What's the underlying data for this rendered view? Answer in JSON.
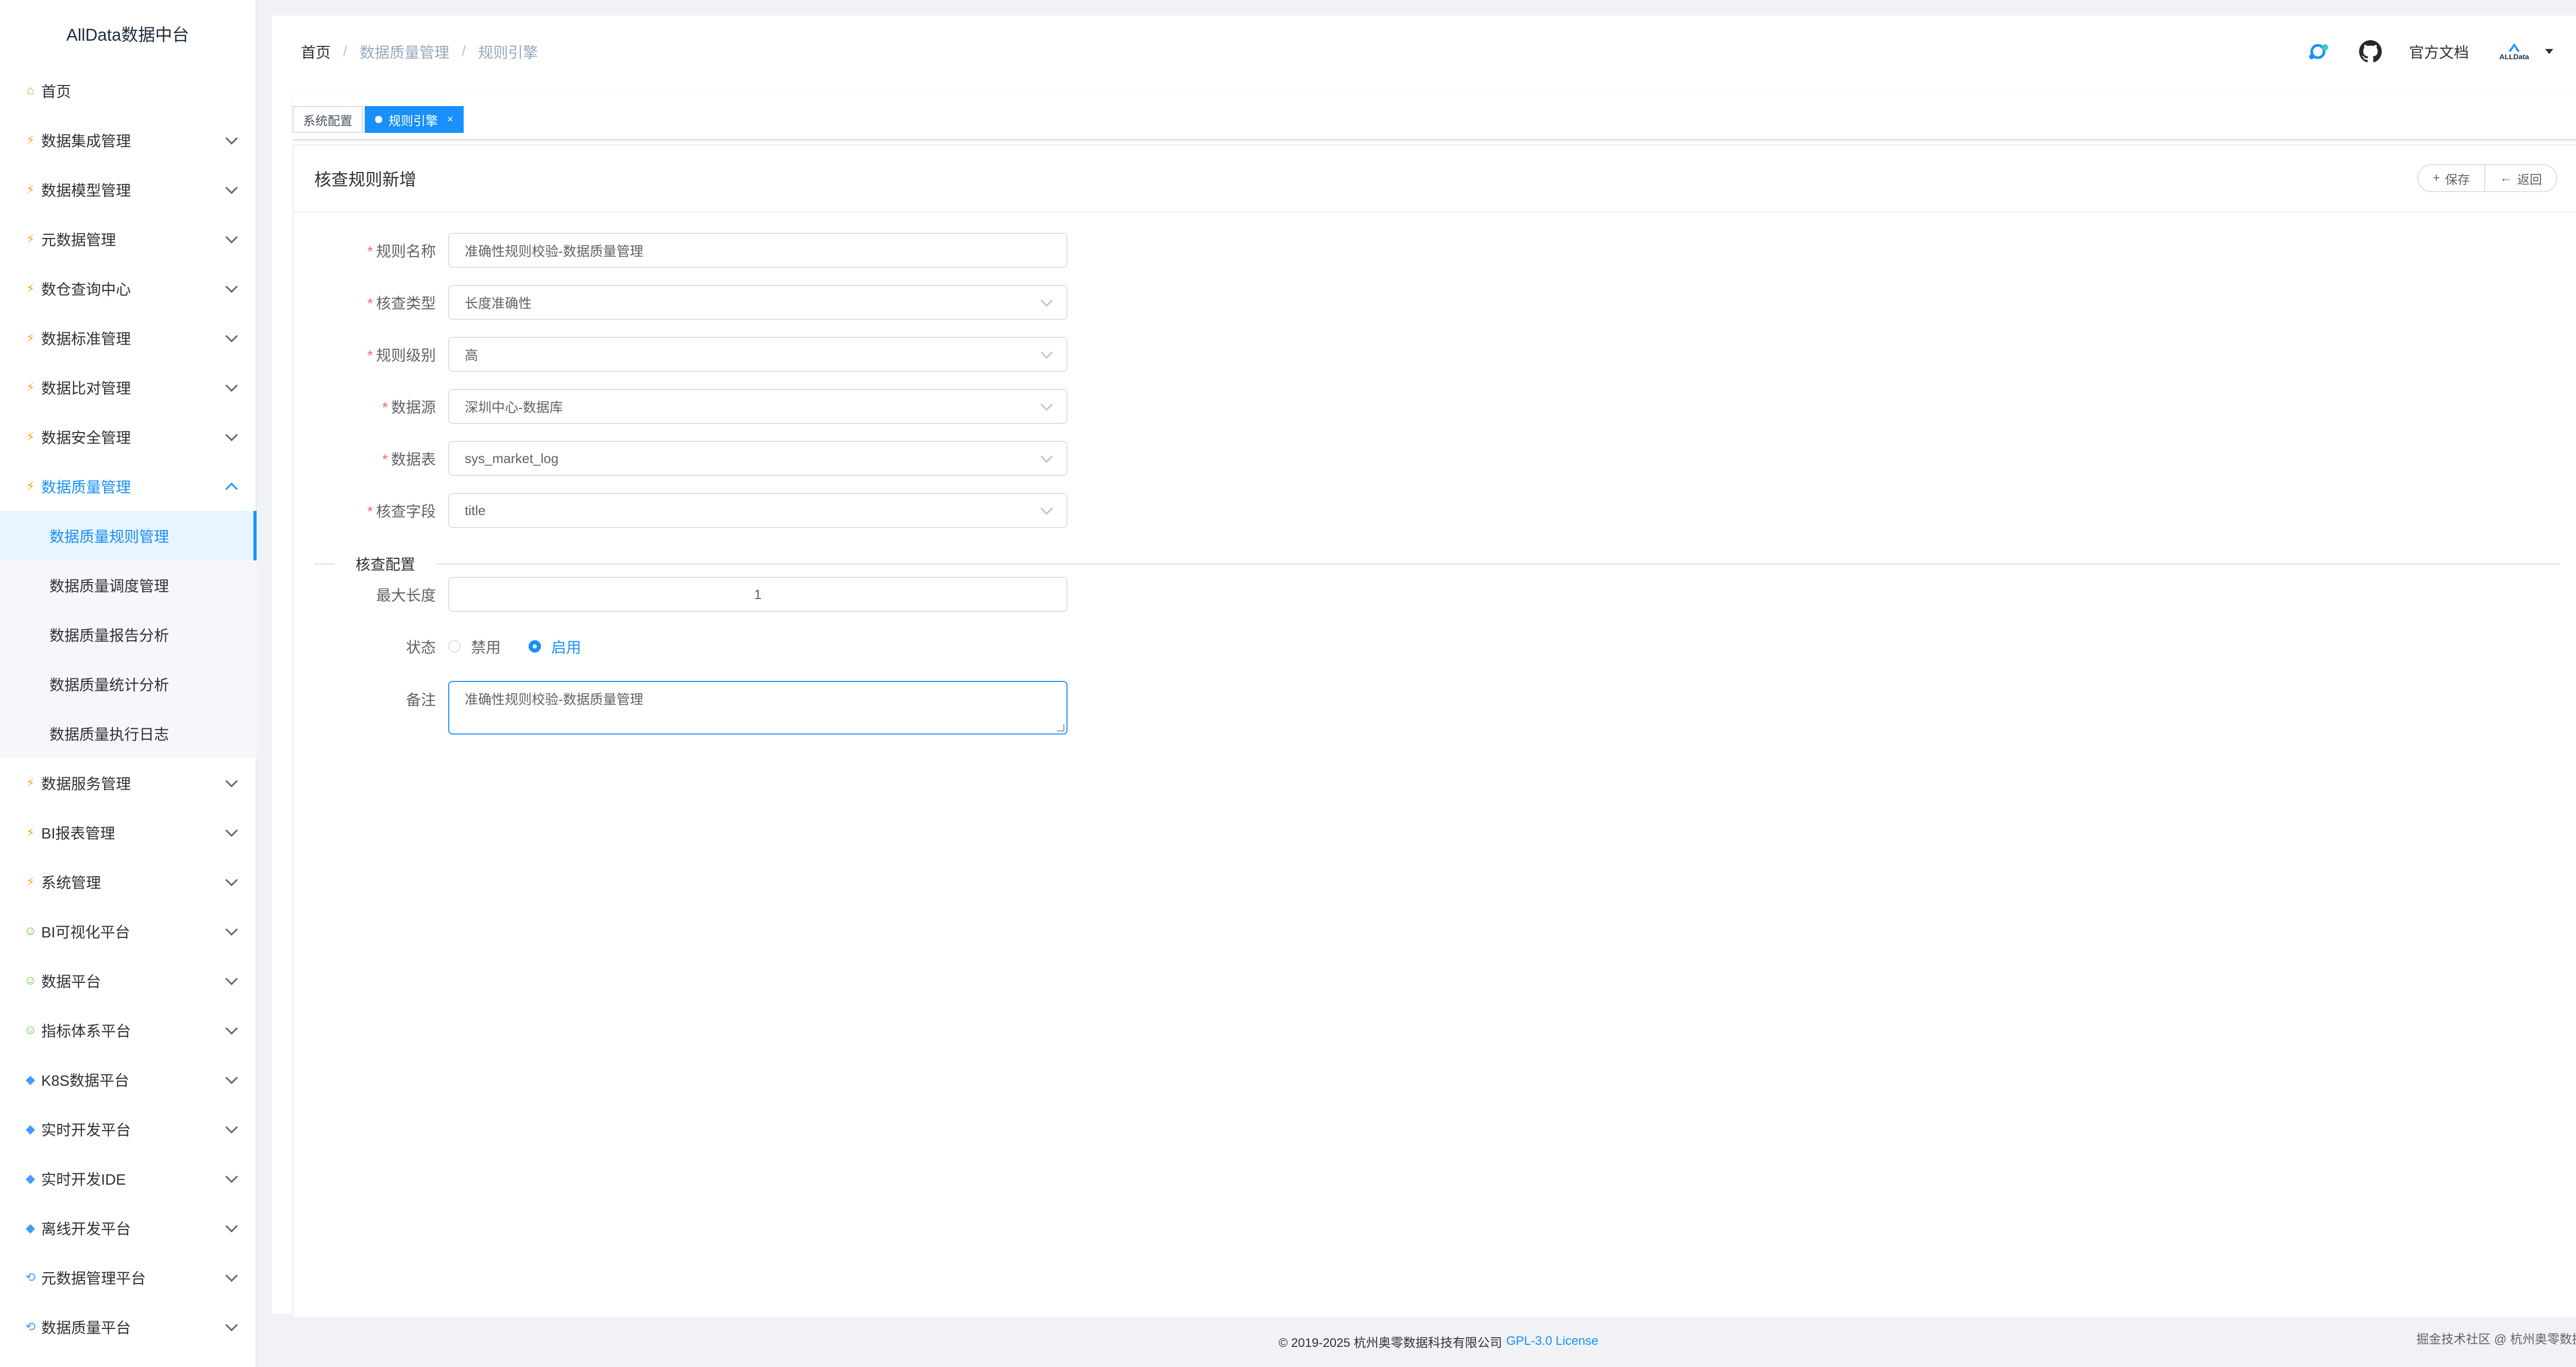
{
  "app_title": "AllData数据中台",
  "sidebar": {
    "items": [
      {
        "label": "首页",
        "icon": "home-icon"
      },
      {
        "label": "数据集成管理",
        "icon": "bolt-icon"
      },
      {
        "label": "数据模型管理",
        "icon": "bolt-icon"
      },
      {
        "label": "元数据管理",
        "icon": "bolt-icon"
      },
      {
        "label": "数仓查询中心",
        "icon": "bolt-icon"
      },
      {
        "label": "数据标准管理",
        "icon": "bolt-icon"
      },
      {
        "label": "数据比对管理",
        "icon": "bolt-icon"
      },
      {
        "label": "数据安全管理",
        "icon": "bolt-icon"
      },
      {
        "label": "数据质量管理",
        "icon": "bolt-icon",
        "expanded": true
      },
      {
        "label": "数据服务管理",
        "icon": "bolt-icon"
      },
      {
        "label": "BI报表管理",
        "icon": "bolt-icon"
      },
      {
        "label": "系统管理",
        "icon": "bolt-icon"
      },
      {
        "label": "BI可视化平台",
        "icon": "person-icon"
      },
      {
        "label": "数据平台",
        "icon": "person-icon"
      },
      {
        "label": "指标体系平台",
        "icon": "person-icon"
      },
      {
        "label": "K8S数据平台",
        "icon": "gem-icon"
      },
      {
        "label": "实时开发平台",
        "icon": "gem-icon"
      },
      {
        "label": "实时开发IDE",
        "icon": "gem-icon"
      },
      {
        "label": "离线开发平台",
        "icon": "gem-icon"
      },
      {
        "label": "元数据管理平台",
        "icon": "cycle-icon"
      },
      {
        "label": "数据质量平台",
        "icon": "cycle-icon"
      }
    ],
    "sub_items": [
      {
        "label": "数据质量规则管理",
        "active": true
      },
      {
        "label": "数据质量调度管理"
      },
      {
        "label": "数据质量报告分析"
      },
      {
        "label": "数据质量统计分析"
      },
      {
        "label": "数据质量执行日志"
      }
    ]
  },
  "breadcrumb": {
    "home": "首页",
    "sep": "/",
    "mid": "数据质量管理",
    "current": "规则引擎"
  },
  "navbar": {
    "docs_label": "官方文档",
    "avatar_text": "ALLData"
  },
  "tags": [
    {
      "label": "系统配置",
      "active": false
    },
    {
      "label": "规则引擎",
      "active": true,
      "close": "×"
    }
  ],
  "card": {
    "title": "核查规则新增",
    "save_label": "保存",
    "save_icon": "+",
    "back_label": "返回",
    "back_icon": "←"
  },
  "form": {
    "required_mark": "*",
    "rule_name": {
      "label": "规则名称",
      "value": "准确性规则校验-数据质量管理"
    },
    "check_type": {
      "label": "核查类型",
      "value": "长度准确性"
    },
    "rule_level": {
      "label": "规则级别",
      "value": "高"
    },
    "datasource": {
      "label": "数据源",
      "value": "深圳中心-数据库"
    },
    "table": {
      "label": "数据表",
      "value": "sys_market_log"
    },
    "column": {
      "label": "核查字段",
      "value": "title"
    },
    "section_title": "核查配置",
    "max_length": {
      "label": "最大长度",
      "value": "1"
    },
    "status": {
      "label": "状态",
      "options": [
        "禁用",
        "启用"
      ],
      "selected": "启用"
    },
    "remark": {
      "label": "备注",
      "value": "准确性规则校验-数据质量管理"
    }
  },
  "footer": {
    "copyright": "© 2019-2025 杭州奥零数据科技有限公司",
    "license": "GPL-3.0 License"
  },
  "watermark": "掘金技术社区 @ 杭州奥零数据科技",
  "colors": {
    "accent": "#1890ff",
    "required": "#f56c6c",
    "sidebar_bg": "#ffffff",
    "page_bg": "#f0f2f5"
  }
}
